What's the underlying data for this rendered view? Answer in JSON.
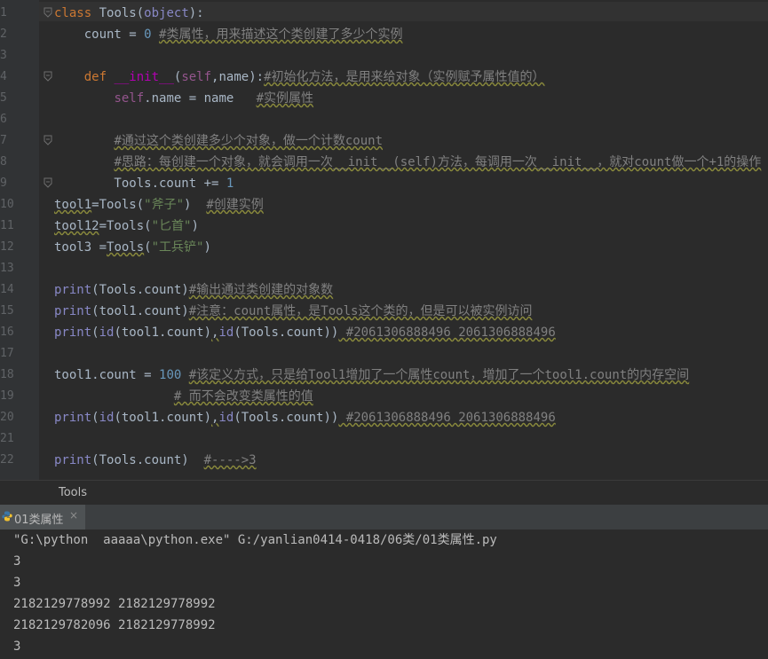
{
  "editor": {
    "lines": [
      {
        "n": "1",
        "fold": true,
        "html": "<span class='kw'>class</span> Tools(<span class='builtin'>object</span>):"
      },
      {
        "n": "2",
        "html": "    count = <span class='num'>0</span> <span class='cmt sq'>#类属性，用来描述这个类创建了多少个实例</span>"
      },
      {
        "n": "3",
        "html": ""
      },
      {
        "n": "4",
        "fold": true,
        "html": "    <span class='kw'>def</span> <span class='magic'>__init__</span>(<span class='selfk'>self</span>,name):<span class='cmt sq'>#初始化方法，是用来给对象（实例赋予属性值的）</span>"
      },
      {
        "n": "5",
        "html": "        <span class='selfk'>self</span>.name = name   <span class='cmt sq'>#实例属性</span>"
      },
      {
        "n": "6",
        "html": ""
      },
      {
        "n": "7",
        "fold": true,
        "html": "        <span class='cmt sq'>#通过这个类创建多少个对象，做一个计数count</span>"
      },
      {
        "n": "8",
        "html": "        <span class='cmt sq'>#思路：每创建一个对象，就会调用一次__init__(self)方法，每调用一次__init__，就对count做一个+1的操作</span>"
      },
      {
        "n": "9",
        "fold": true,
        "html": "        Tools.count += <span class='num'>1</span>"
      },
      {
        "n": "10",
        "html": "<span class='sq'>tool1</span>=Tools(<span class='str'>\"斧子\"</span>)  <span class='cmt sq'>#创建实例</span>"
      },
      {
        "n": "11",
        "html": "<span class='sq'>tool12</span>=Tools(<span class='str'>\"匕首\"</span>)"
      },
      {
        "n": "12",
        "html": "tool3 =<span class='sq'>Tools</span>(<span class='str'>\"工兵铲\"</span>)"
      },
      {
        "n": "13",
        "html": ""
      },
      {
        "n": "14",
        "html": "<span class='builtin'>print</span>(Tools.count)<span class='cmt sq'>#输出通过类创建的对象数</span>"
      },
      {
        "n": "15",
        "html": "<span class='builtin'>print</span>(tool1.count)<span class='cmt sq'>#注意：count属性，是Tools这个类的，但是可以被实例访问</span>"
      },
      {
        "n": "16",
        "html": "<span class='builtin'>print</span>(<span class='builtin'>id</span>(tool1.count)<span class='sq'>,</span><span class='builtin'>id</span>(Tools.count))<span class='cmt sq'> #2061306888496 2061306888496</span>"
      },
      {
        "n": "17",
        "html": ""
      },
      {
        "n": "18",
        "html": "tool1.count = <span class='num'>100</span> <span class='cmt sq'>#该定义方式，只是给Tool1增加了一个属性count，增加了一个tool1.count的内存空间</span>"
      },
      {
        "n": "19",
        "html": "                <span class='cmt sq'># 而不会改变类属性的值</span>"
      },
      {
        "n": "20",
        "html": "<span class='builtin'>print</span>(<span class='builtin'>id</span>(tool1.count)<span class='sq'>,</span><span class='builtin'>id</span>(Tools.count))<span class='cmt sq'> #2061306888496 2061306888496</span>"
      },
      {
        "n": "21",
        "html": ""
      },
      {
        "n": "22",
        "html": "<span class='builtin'>print</span>(Tools.count)  <span class='cmt sq'>#---->3</span>"
      }
    ]
  },
  "breadcrumb": {
    "label": "Tools"
  },
  "run_tab": {
    "label": "01类属性",
    "close": "×"
  },
  "console": {
    "lines": [
      "\"G:\\python  aaaaa\\python.exe\" G:/yanlian0414-0418/06类/01类属性.py",
      "3",
      "3",
      "2182129778992 2182129778992",
      "2182129782096 2182129778992",
      "3"
    ]
  },
  "colors": {
    "background": "#2b2b2b",
    "keyword": "#cc7832",
    "number": "#6897bb",
    "string": "#6a8759",
    "comment": "#808080"
  },
  "icons": {
    "tab_icon": "python-icon",
    "fold_icon": "fold-icon",
    "close_icon": "close-icon"
  }
}
